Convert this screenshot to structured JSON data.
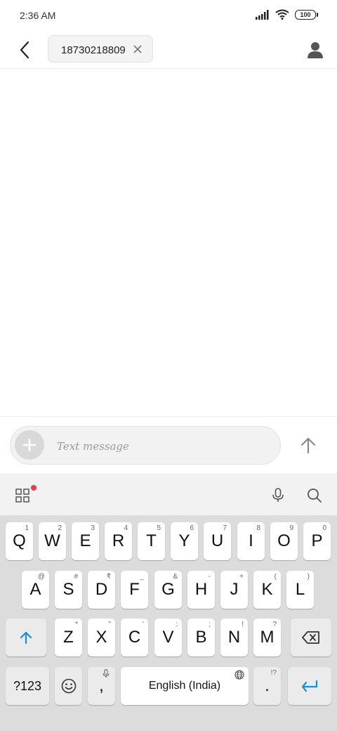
{
  "status": {
    "time": "2:36 AM",
    "battery": "100"
  },
  "header": {
    "recipient": "18730218809"
  },
  "compose": {
    "placeholder": "Text message"
  },
  "colors": {
    "accent": "#1a8fd8",
    "badge": "#e94040"
  },
  "keyboard": {
    "row1": [
      {
        "key": "Q",
        "hint": "1"
      },
      {
        "key": "W",
        "hint": "2"
      },
      {
        "key": "E",
        "hint": "3"
      },
      {
        "key": "R",
        "hint": "4"
      },
      {
        "key": "T",
        "hint": "5"
      },
      {
        "key": "Y",
        "hint": "6"
      },
      {
        "key": "U",
        "hint": "7"
      },
      {
        "key": "I",
        "hint": "8"
      },
      {
        "key": "O",
        "hint": "9"
      },
      {
        "key": "P",
        "hint": "0"
      }
    ],
    "row2": [
      {
        "key": "A",
        "hint": "@"
      },
      {
        "key": "S",
        "hint": "#"
      },
      {
        "key": "D",
        "hint": "₹"
      },
      {
        "key": "F",
        "hint": "_"
      },
      {
        "key": "G",
        "hint": "&"
      },
      {
        "key": "H",
        "hint": "-"
      },
      {
        "key": "J",
        "hint": "+"
      },
      {
        "key": "K",
        "hint": "("
      },
      {
        "key": "L",
        "hint": ")"
      }
    ],
    "row3": [
      {
        "key": "Z",
        "hint": "*"
      },
      {
        "key": "X",
        "hint": "\""
      },
      {
        "key": "C",
        "hint": "'"
      },
      {
        "key": "V",
        "hint": ":"
      },
      {
        "key": "B",
        "hint": ";"
      },
      {
        "key": "N",
        "hint": "!"
      },
      {
        "key": "M",
        "hint": "?"
      }
    ],
    "symbols_label": "?123",
    "comma": ",",
    "space_label": "English (India)",
    "period": ".",
    "period_hint": "!?"
  }
}
